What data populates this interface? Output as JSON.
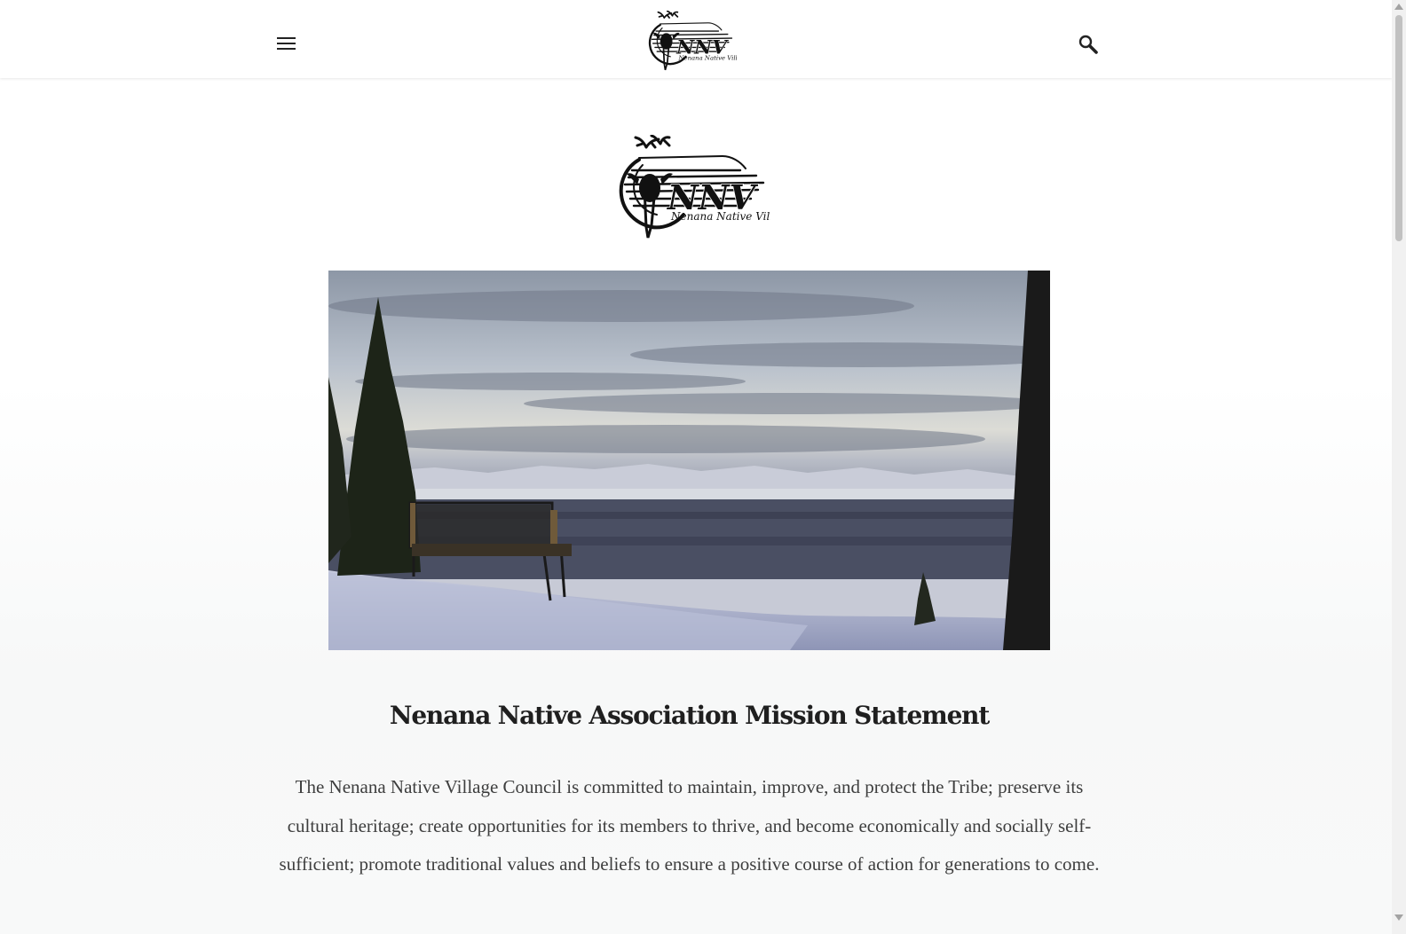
{
  "header": {
    "menu_icon": "hamburger-menu-icon",
    "logo_alt": "NNV Nenana Native Village",
    "search_icon": "search-icon"
  },
  "logo": {
    "letters": "NNV",
    "tagline": "Nenana Native Village"
  },
  "hero_image": {
    "alt": "Winter view with bench overlooking snowy forest and distant mountains at sunset"
  },
  "mission": {
    "title": "Nenana Native Association Mission Statement",
    "body": "The Nenana Native Village Council is committed to maintain, improve, and protect the Tribe; preserve its cultural heritage; create opportunities for its members to thrive, and become economically and socially self-sufficient; promote traditional values and beliefs to ensure a positive course of action for generations to come."
  },
  "colors": {
    "header_bg": "#ffffff",
    "page_bg": "#f8f9f9",
    "title_text": "#1f1f1f",
    "body_text": "#3e3e3e",
    "icon": "#222222"
  }
}
